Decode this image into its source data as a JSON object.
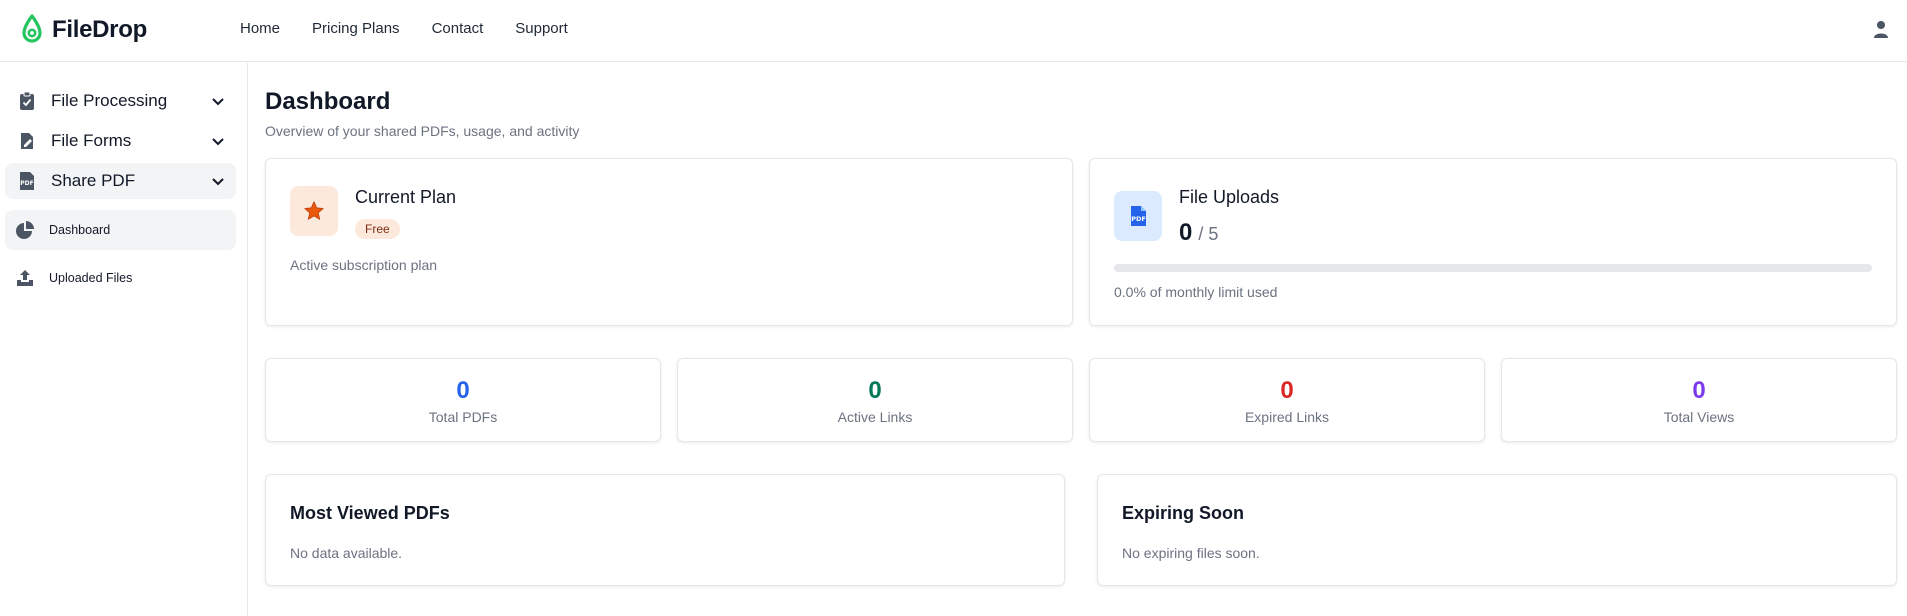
{
  "app": {
    "name": "FileDrop"
  },
  "nav": {
    "items": [
      "Home",
      "Pricing Plans",
      "Contact",
      "Support"
    ]
  },
  "sidebar": {
    "groups": [
      {
        "label": "File Processing",
        "icon": "clipboard-check-icon"
      },
      {
        "label": "File Forms",
        "icon": "file-edit-icon"
      },
      {
        "label": "Share PDF",
        "icon": "pdf-file-icon"
      }
    ],
    "items": [
      {
        "label": "Dashboard",
        "icon": "pie-chart-icon"
      },
      {
        "label": "Uploaded Files",
        "icon": "upload-icon"
      }
    ]
  },
  "dashboard": {
    "title": "Dashboard",
    "subtitle": "Overview of your shared PDFs, usage, and activity"
  },
  "plan": {
    "title": "Current Plan",
    "badge": "Free",
    "description": "Active subscription plan"
  },
  "uploads": {
    "title": "File Uploads",
    "used": "0",
    "limit": "/ 5",
    "usage_fraction": 0.0,
    "description": "0.0% of monthly limit used"
  },
  "stats": [
    {
      "value": "0",
      "label": "Total PDFs",
      "color": "#2563eb"
    },
    {
      "value": "0",
      "label": "Active Links",
      "color": "#047857"
    },
    {
      "value": "0",
      "label": "Expired Links",
      "color": "#dc2626"
    },
    {
      "value": "0",
      "label": "Total Views",
      "color": "#7c3aed"
    }
  ],
  "most_viewed": {
    "title": "Most Viewed PDFs",
    "empty": "No data available."
  },
  "expiring": {
    "title": "Expiring Soon",
    "empty": "No expiring files soon."
  },
  "colors": {
    "brand": "#22c55e",
    "accent": "#2563eb",
    "plan_accent": "#ea580c"
  }
}
